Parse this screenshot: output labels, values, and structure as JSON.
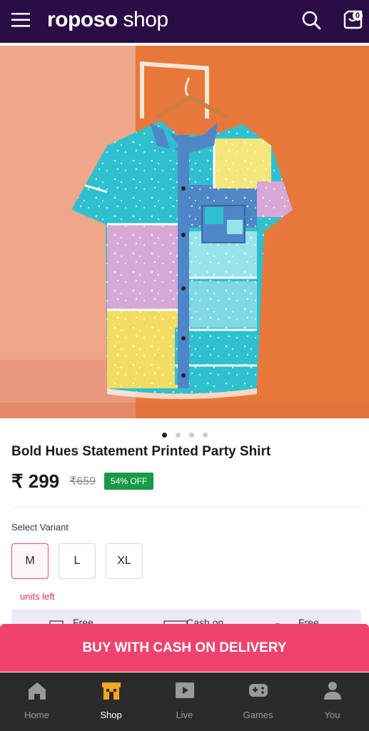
{
  "header": {
    "logo_main": "roposo",
    "logo_shop": " shop",
    "cart_count": "0",
    "menu_icon": "hamburger-menu-icon",
    "search_icon": "search-icon",
    "cart_icon": "cart-icon"
  },
  "gallery": {
    "image": "product-image-shirt",
    "slides": 4,
    "active_slide": 1
  },
  "product": {
    "title": "Bold Hues Statement Printed Party Shirt",
    "price": "₹ 299",
    "mrp": "₹659",
    "discount": "54% OFF"
  },
  "variant": {
    "label": "Select Variant",
    "options": [
      "M",
      "L",
      "XL"
    ],
    "selected": "M",
    "stock_note": "units left"
  },
  "benefits": {
    "items": [
      "Free",
      "Cash on",
      "Free"
    ]
  },
  "cta": {
    "buy_label": "BUY WITH CASH ON DELIVERY"
  },
  "nav": {
    "items": [
      {
        "label": "Home",
        "icon": "home-icon"
      },
      {
        "label": "Shop",
        "icon": "shop-icon"
      },
      {
        "label": "Live",
        "icon": "live-icon"
      },
      {
        "label": "Games",
        "icon": "games-icon"
      },
      {
        "label": "You",
        "icon": "profile-icon"
      }
    ],
    "active": "Shop"
  },
  "colors": {
    "header_bg": "#2a0d45",
    "cta_bg": "#f0426e",
    "discount_badge": "#1a9a46",
    "nav_bg": "#2b2b2b",
    "active_nav": "#f5a623"
  }
}
